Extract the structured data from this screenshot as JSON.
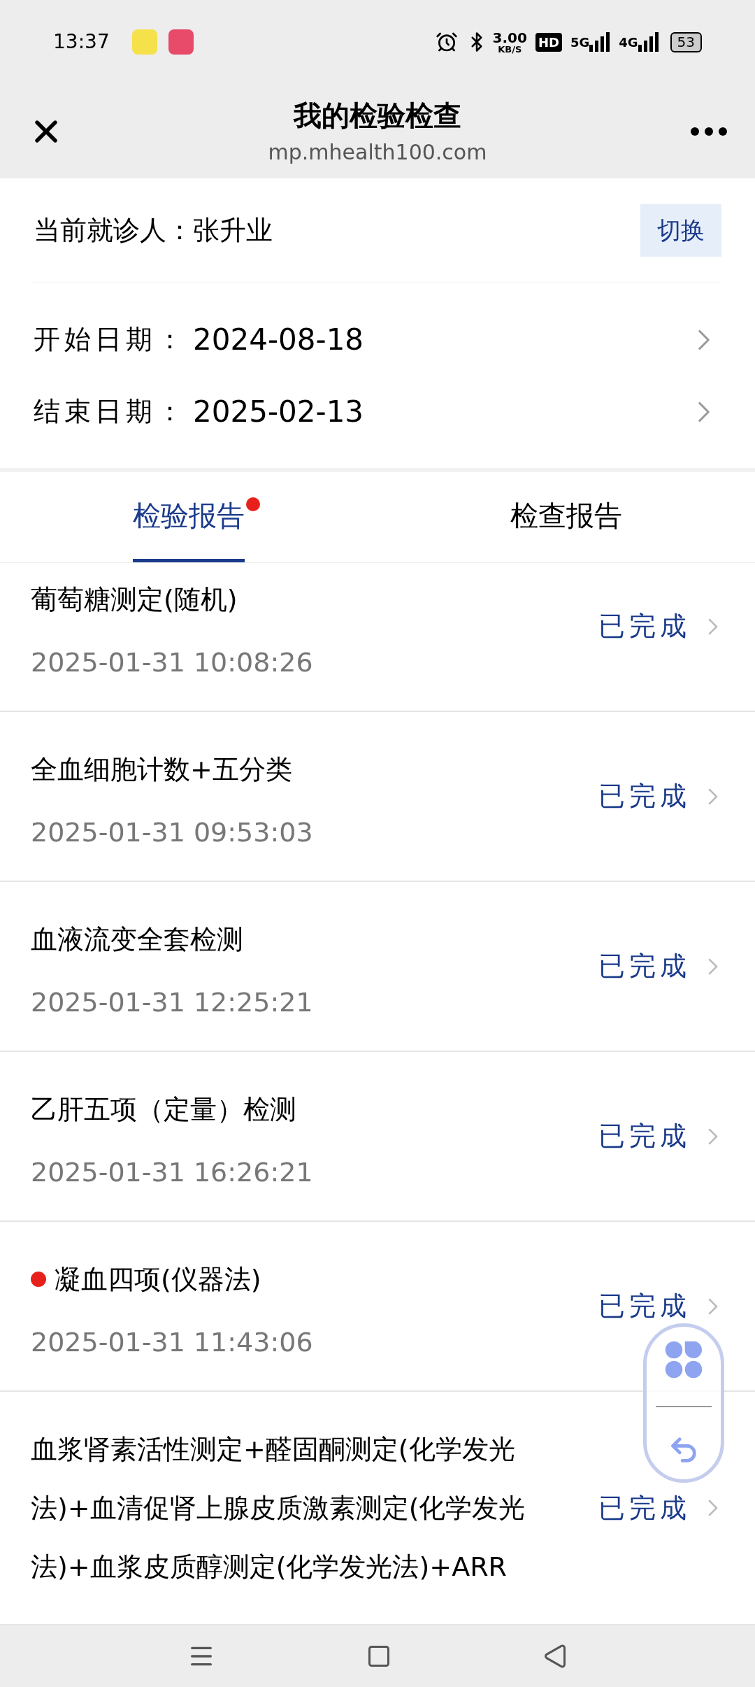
{
  "status_bar": {
    "time": "13:37",
    "speed": "3.00",
    "speed_unit": "KB/S",
    "hd": "HD",
    "network_5g": "5G",
    "network_4g": "4G",
    "battery": "53"
  },
  "header": {
    "title": "我的检验检查",
    "subtitle": "mp.mhealth100.com"
  },
  "patient": {
    "label": "当前就诊人：张升业",
    "switch_button": "切换"
  },
  "dates": [
    {
      "label": "开始日期：",
      "value": "2024-08-18"
    },
    {
      "label": "结束日期：",
      "value": "2025-02-13"
    }
  ],
  "tabs": [
    {
      "label": "检验报告",
      "selected": true,
      "unread": true
    },
    {
      "label": "检查报告",
      "selected": false,
      "unread": false
    }
  ],
  "reports": [
    {
      "title": "葡萄糖测定(随机)",
      "time": "2025-01-31 10:08:26",
      "status": "已完成",
      "unread": false
    },
    {
      "title": "全血细胞计数+五分类",
      "time": "2025-01-31 09:53:03",
      "status": "已完成",
      "unread": false
    },
    {
      "title": "血液流变全套检测",
      "time": "2025-01-31 12:25:21",
      "status": "已完成",
      "unread": false
    },
    {
      "title": "乙肝五项（定量）检测",
      "time": "2025-01-31 16:26:21",
      "status": "已完成",
      "unread": false
    },
    {
      "title": "凝血四项(仪器法)",
      "time": "2025-01-31 11:43:06",
      "status": "已完成",
      "unread": true
    },
    {
      "title": "血浆肾素活性测定+醛固酮测定(化学发光法)+血清促肾上腺皮质激素测定(化学发光法)+血浆皮质醇测定(化学发光法)+ARR",
      "status": "已完成",
      "unread": false
    }
  ]
}
